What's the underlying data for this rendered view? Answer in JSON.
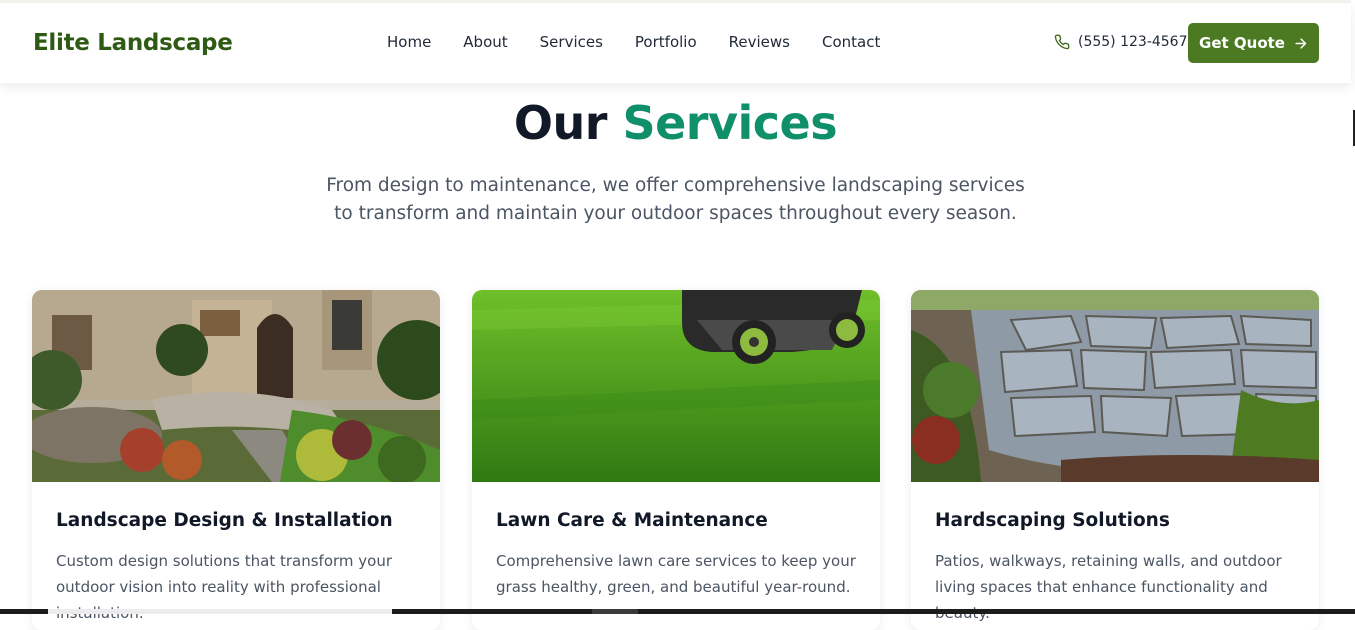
{
  "header": {
    "logo": "Elite Landscape",
    "nav": [
      "Home",
      "About",
      "Services",
      "Portfolio",
      "Reviews",
      "Contact"
    ],
    "phone": "(555) 123-4567",
    "phone_icon": "phone-icon",
    "cta_label": "Get Quote",
    "cta_icon": "arrow-right-icon"
  },
  "hero": {
    "title_part1": "Our",
    "title_part2": "Services",
    "subtitle": "From design to maintenance, we offer comprehensive landscaping services to transform and maintain your outdoor spaces throughout every season."
  },
  "services": [
    {
      "title": "Landscape Design & Installation",
      "description": "Custom design solutions that transform your outdoor vision into reality with professional installation."
    },
    {
      "title": "Lawn Care & Maintenance",
      "description": "Comprehensive lawn care services to keep your grass healthy, green, and beautiful year-round."
    },
    {
      "title": "Hardscaping Solutions",
      "description": "Patios, walkways, retaining walls, and outdoor living spaces that enhance functionality and beauty."
    }
  ],
  "colors": {
    "brand_green": "#2f5a14",
    "button_green": "#4b7a23",
    "accent_teal": "#0f8f6a"
  }
}
